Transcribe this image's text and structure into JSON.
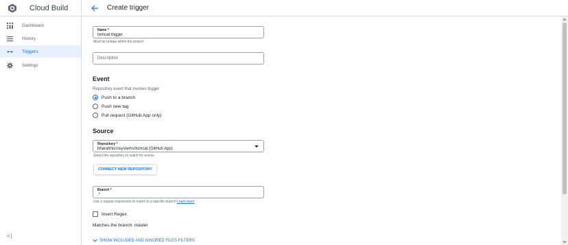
{
  "app": {
    "title": "Cloud Build"
  },
  "sidebar": {
    "items": [
      {
        "label": "Dashboard",
        "icon": "dashboard-icon",
        "active": false
      },
      {
        "label": "History",
        "icon": "history-list-icon",
        "active": false
      },
      {
        "label": "Triggers",
        "icon": "triggers-arrow-icon",
        "active": true
      },
      {
        "label": "Settings",
        "icon": "gear-icon",
        "active": false
      }
    ],
    "collapse_label": "<|"
  },
  "header": {
    "title": "Create trigger"
  },
  "form": {
    "name": {
      "label": "Name *",
      "value": "tomcat-trigger",
      "hint": "Must be unique within the project"
    },
    "description": {
      "placeholder": "Description"
    },
    "event": {
      "title": "Event",
      "subtitle": "Repository event that invokes trigger",
      "options": [
        {
          "label": "Push to a branch",
          "checked": true
        },
        {
          "label": "Push new tag",
          "checked": false
        },
        {
          "label": "Pull request (GitHub App only)",
          "checked": false
        }
      ]
    },
    "source": {
      "title": "Source",
      "repository": {
        "label": "Repository *",
        "value": "bharatmicrosystems/tomcat (GitHub App)",
        "hint": "Select the repository to watch for events"
      },
      "connect_button": "CONNECT NEW REPOSITORY",
      "branch": {
        "label": "Branch *",
        "value": ".*",
        "hint": "Use a regular expression to match to a specific branch",
        "hint_link": "Learn more"
      },
      "invert_regex": {
        "label": "Invert Regex",
        "checked": false
      },
      "matches": "Matches the branch: master",
      "filters_toggle": "SHOW INCLUDED AND IGNORED FILES FILTERS"
    }
  },
  "colors": {
    "accent": "#1a73e8",
    "active_bg": "#e8f0fe",
    "border": "#dadce0"
  }
}
